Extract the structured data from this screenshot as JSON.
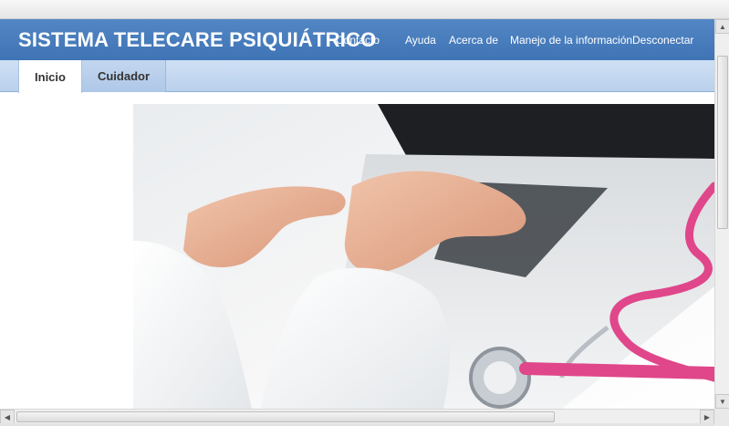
{
  "header": {
    "title": "SISTEMA TELECARE PSIQUIÁTRICO",
    "nav": {
      "contacto": "Contacto",
      "ayuda": "Ayuda",
      "acerca": "Acerca de",
      "manejo": "Manejo de la información",
      "desconectar": "Desconectar"
    }
  },
  "tabs": [
    {
      "label": "Inicio",
      "active": true
    },
    {
      "label": "Cuidador",
      "active": false
    }
  ],
  "colors": {
    "header": "#4a7fbf",
    "tabbar": "#c3d6ee",
    "stethoscope": "#e0468a"
  },
  "hero": {
    "icon": "laptop-stethoscope-photo"
  }
}
